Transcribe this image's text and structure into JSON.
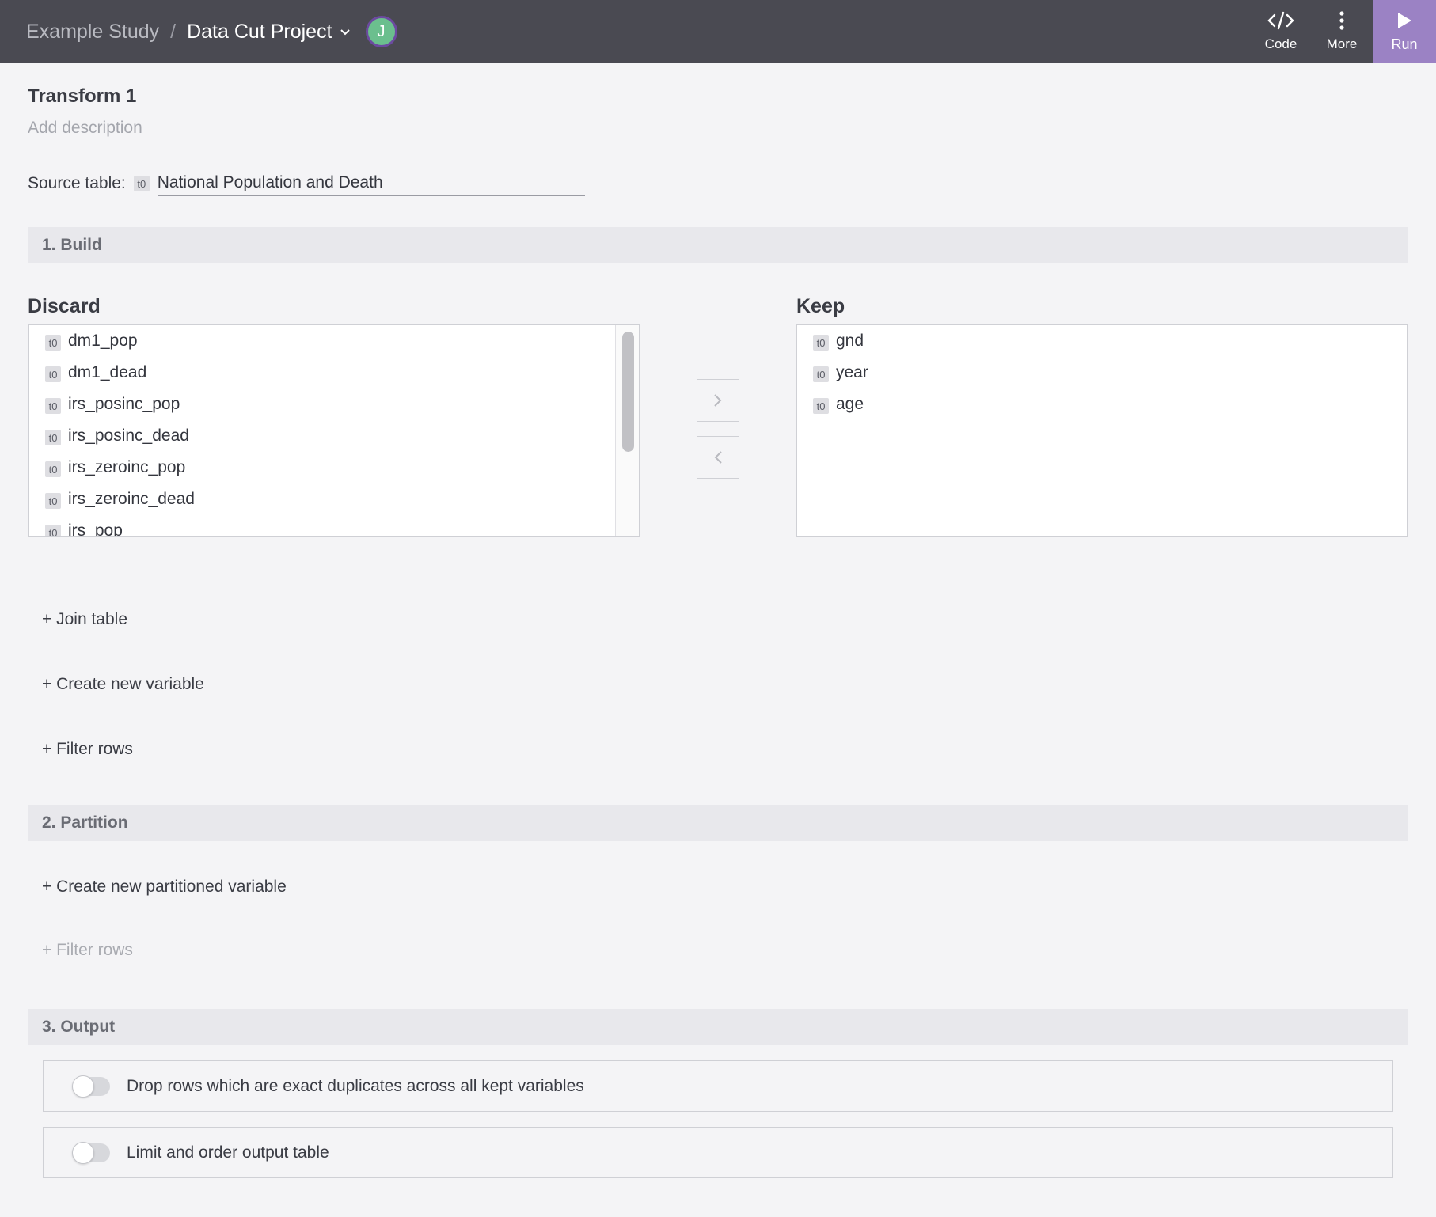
{
  "header": {
    "study": "Example Study",
    "separator": "/",
    "project": "Data Cut Project",
    "avatar_initial": "J",
    "tools": {
      "code": "Code",
      "more": "More",
      "run": "Run"
    }
  },
  "transform": {
    "title": "Transform 1",
    "description_placeholder": "Add description",
    "source_label": "Source table:",
    "source_tag": "t0",
    "source_value": "National Population and Death"
  },
  "sections": {
    "build": "1. Build",
    "partition": "2. Partition",
    "output": "3. Output"
  },
  "discard": {
    "title": "Discard",
    "items": [
      {
        "tag": "t0",
        "name": "dm1_pop"
      },
      {
        "tag": "t0",
        "name": "dm1_dead"
      },
      {
        "tag": "t0",
        "name": "irs_posinc_pop"
      },
      {
        "tag": "t0",
        "name": "irs_posinc_dead"
      },
      {
        "tag": "t0",
        "name": "irs_zeroinc_pop"
      },
      {
        "tag": "t0",
        "name": "irs_zeroinc_dead"
      },
      {
        "tag": "t0",
        "name": "irs_pop"
      }
    ]
  },
  "keep": {
    "title": "Keep",
    "items": [
      {
        "tag": "t0",
        "name": "gnd"
      },
      {
        "tag": "t0",
        "name": "year"
      },
      {
        "tag": "t0",
        "name": "age"
      }
    ]
  },
  "build_actions": {
    "join": "+ Join table",
    "create_var": "+ Create new variable",
    "filter": "+ Filter rows"
  },
  "partition_actions": {
    "create_partitioned": "+ Create new partitioned variable",
    "filter": "+ Filter rows"
  },
  "output_options": {
    "drop_duplicates": {
      "label": "Drop rows which are exact duplicates across all kept variables",
      "enabled": false
    },
    "limit_order": {
      "label": "Limit and order output table",
      "enabled": false
    }
  },
  "colors": {
    "topbar": "#4a4a52",
    "run": "#9b82c4",
    "avatar": "#6bbf8e"
  },
  "icons": {
    "code": "code-icon",
    "more": "more-vertical-icon",
    "run": "play-icon",
    "move_right": "chevron-right-icon",
    "move_left": "chevron-left-icon"
  }
}
